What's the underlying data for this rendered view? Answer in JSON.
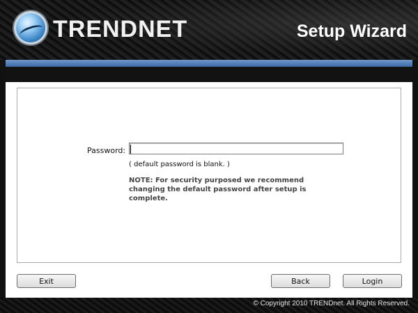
{
  "header": {
    "brand": "TRENDNET",
    "title": "Setup Wizard"
  },
  "form": {
    "password_label": "Password:",
    "password_value": "",
    "hint": "( default password is blank.  )",
    "note": "NOTE: For security purposed we recommend changing the default password after setup is complete."
  },
  "buttons": {
    "exit": "Exit",
    "back": "Back",
    "login": "Login"
  },
  "footer": {
    "copyright": "© Copyright 2010 TRENDnet. All Rights Reserved."
  },
  "colors": {
    "accent_bar": "#4a78b6",
    "background": "#111111"
  }
}
